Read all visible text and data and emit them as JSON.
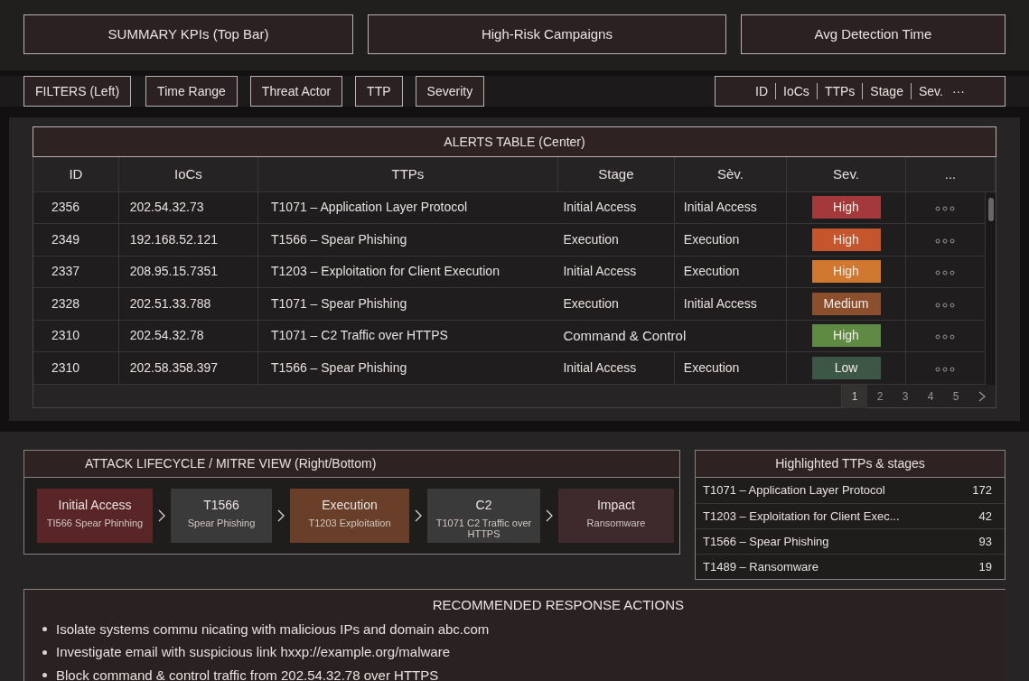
{
  "kpis": [
    "SUMMARY KPIs (Top Bar)",
    "High-Risk Campaigns",
    "Avg Detection Time"
  ],
  "filters": {
    "label": "FILTERS (Left)",
    "buttons": [
      "Time Range",
      "Threat Actor",
      "TTP",
      "Severity"
    ],
    "columns": [
      "ID",
      "IoCs",
      "TTPs",
      "Stage",
      "Sev.",
      "···"
    ]
  },
  "alerts_table": {
    "title": "ALERTS TABLE (Center)",
    "columns": [
      "ID",
      "IoCs",
      "TTPs",
      "Stage",
      "Sèv.",
      "Sev.",
      "..."
    ],
    "rows": [
      {
        "id": "2356",
        "ioc": "202.54.32.73",
        "ttp": "T1071 – Application Layer Protocol",
        "stage": "Initial Access",
        "column_5": "Initial Access",
        "severity": "High",
        "color": "#a3393a"
      },
      {
        "id": "2349",
        "ioc": "192.168.52.121",
        "ttp": "T1566 – Spear Phishing",
        "stage": "Execution",
        "column_5": "Execution",
        "severity": "High",
        "color": "#c4552c"
      },
      {
        "id": "2337",
        "ioc": "208.95.15.7351",
        "ttp": "T1203 – Exploitation for Client Execution",
        "stage": "Initial Access",
        "column_5": "Execution",
        "severity": "High",
        "color": "#d0782f"
      },
      {
        "id": "2328",
        "ioc": "202.51.33.788",
        "ttp": "T1071 – Spear Phishing",
        "stage": "Execution",
        "column_5": "Initial Access",
        "severity": "Medium",
        "color": "#8c4f2e"
      },
      {
        "id": "2310",
        "ioc": "202.54.32.78",
        "ttp": "T1071 – C2 Traffic over HTTPS",
        "stage": "Command & Control",
        "severity": "High",
        "color": "#5e8a44"
      },
      {
        "id": "2310",
        "ioc": "202.58.358.397",
        "ttp": "T1566 – Spear Phishing",
        "stage": "Initial Access",
        "column_5": "Execution",
        "severity": "Low",
        "color": "#3d5747"
      }
    ],
    "pages": [
      {
        "label": "1",
        "selected": true
      },
      {
        "label": "2",
        "selected": false
      },
      {
        "label": "3",
        "selected": false
      },
      {
        "label": "4",
        "selected": false
      },
      {
        "label": "5",
        "selected": false
      }
    ]
  },
  "lifecycle": {
    "title": "ATTACK LIFECYCLE / MITRE VIEW (Right/Bottom)",
    "stages": [
      {
        "title": "Initial Access",
        "detail": "TI566 Spear Phinhing",
        "color": "#5a2527"
      },
      {
        "title": "T1566",
        "detail": "Spear Phishing",
        "color": "#3b3a3a"
      },
      {
        "title": "Execution",
        "detail": "T1203 Exploitation",
        "color": "#6a3f29"
      },
      {
        "title": "C2",
        "detail": "T1071 C2 Traffic over HTTPS",
        "color": "#3b3a3a"
      },
      {
        "title": "Impact",
        "detail": "Ransomware",
        "color": "#3e2a2c"
      }
    ]
  },
  "highlighted": {
    "title": "Highlighted TTPs & stages",
    "items": [
      {
        "name": "T1071 – Application Layer Protocol",
        "count": "172"
      },
      {
        "name": "T1203 – Exploitation for Client Exec...",
        "count": "42"
      },
      {
        "name": "T1566 – Spear Phishing",
        "count": "93"
      },
      {
        "name": "T1489 – Ransomware",
        "count": "19"
      }
    ]
  },
  "actions": {
    "title": "RECOMMENDED RESPONSE ACTIONS",
    "items": [
      "Isolate systems commu nicating with malicious IPs and domain abc.com",
      "Investigate email with suspicious link hxxp://example.org/malware",
      "Block command & control traffic from 202.54.32.78 over HTTPS"
    ]
  }
}
